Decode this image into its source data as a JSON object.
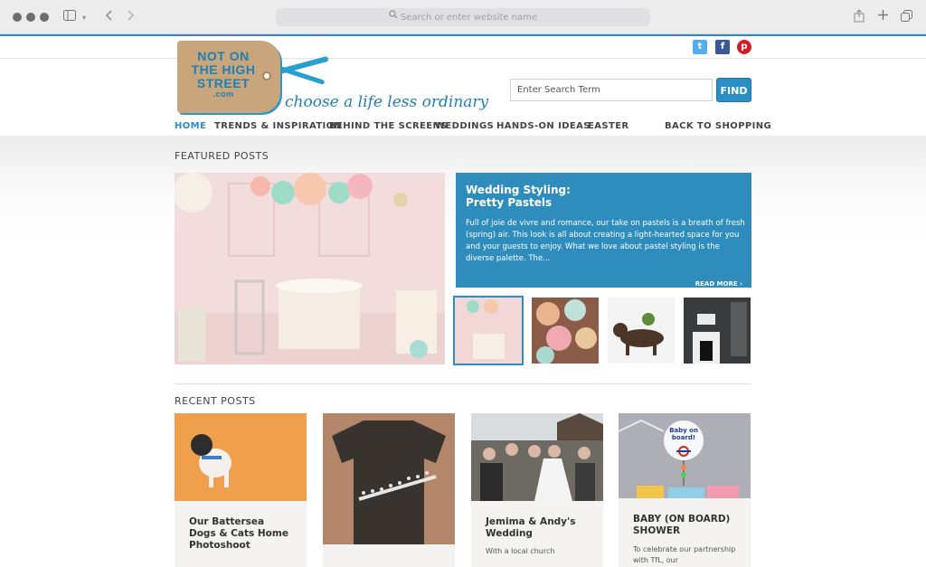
{
  "browser": {
    "url_placeholder": "Search or enter website name"
  },
  "social": {
    "twitter": "t",
    "facebook": "f",
    "pinterest": "p"
  },
  "logo": {
    "line1": "NOT ON",
    "line2": "THE HIGH",
    "line3": "STREET",
    "dotcom": ".com",
    "tagline": "choose a life less ordinary"
  },
  "search": {
    "placeholder": "Enter Search Term",
    "button": "FIND"
  },
  "nav": {
    "items": [
      "HOME",
      "TRENDS & INSPIRATION",
      "BEHIND THE SCREENS",
      "WEDDINGS",
      "HANDS-ON IDEAS",
      "EASTER"
    ],
    "back": "BACK TO SHOPPING"
  },
  "featured": {
    "heading": "FEATURED POSTS",
    "title_line1": "Wedding Styling:",
    "title_line2": "Pretty Pastels",
    "text": "Full of joie de vivre and romance, our take on pastels is a breath of fresh (spring) air. This look is all about creating a light-hearted space for you and your guests to enjoy. What we love about pastel styling is the diverse palette. The...",
    "read_more": "READ MORE ›"
  },
  "recent": {
    "heading": "RECENT POSTS",
    "cards": [
      {
        "title": "Our Battersea Dogs & Cats Home Photoshoot",
        "text": ""
      },
      {
        "title": "",
        "text": ""
      },
      {
        "title": "Jemima & Andy's Wedding",
        "text": "With a local church"
      },
      {
        "title": "BABY (ON BOARD) SHOWER",
        "text": "To celebrate our partnership with TfL, our"
      }
    ]
  },
  "balloon_text": "Baby on board!",
  "colors": {
    "accent": "#2b8ec4",
    "feature_bg": "#2e8dbd",
    "logo_tag": "#c9a57b"
  }
}
